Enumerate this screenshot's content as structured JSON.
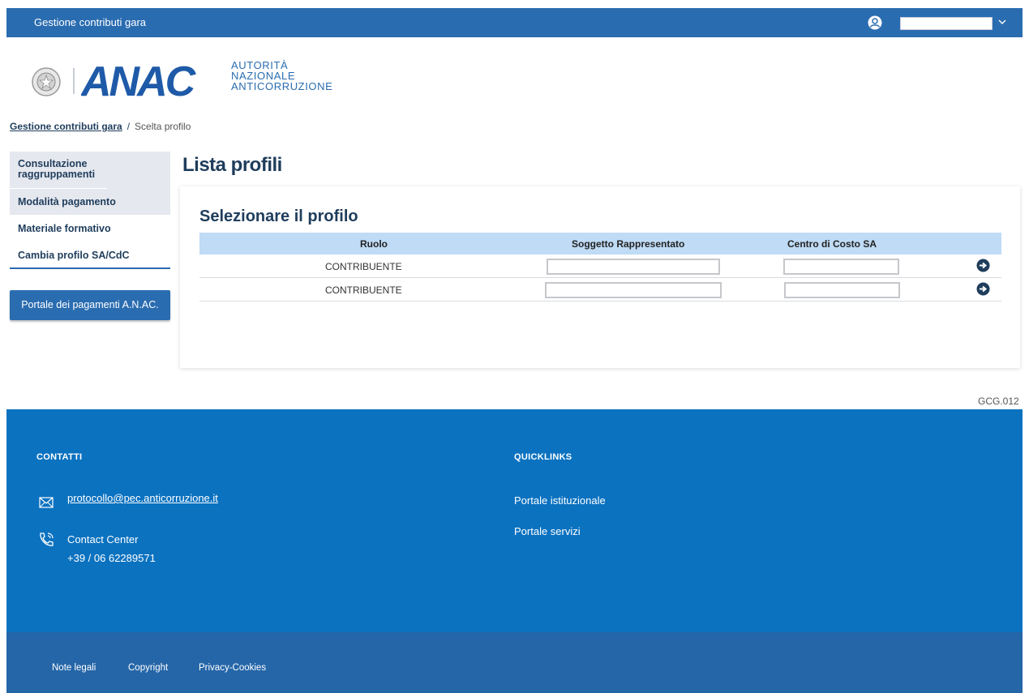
{
  "header": {
    "app_title": "Gestione contributi gara",
    "user_name": ""
  },
  "logo": {
    "line1": "AUTORITÀ",
    "line2": "NAZIONALE",
    "line3": "ANTICORRUZIONE",
    "mark": "ANAC",
    "emblem": "repubblica-emblem-icon"
  },
  "breadcrumb": {
    "root": "Gestione contributi gara",
    "separator": "/",
    "current": "Scelta profilo"
  },
  "sidebar": {
    "items": [
      {
        "label": "Consultazione raggruppamenti"
      },
      {
        "label": "Modalità pagamento"
      },
      {
        "label": "Materiale formativo"
      },
      {
        "label": "Cambia profilo SA/CdC"
      }
    ],
    "portal_button": "Portale dei pagamenti A.N.AC."
  },
  "main": {
    "page_title": "Lista profili",
    "card_title": "Selezionare il profilo",
    "columns": [
      "Ruolo",
      "Soggetto Rappresentato",
      "Centro di Costo SA"
    ],
    "rows": [
      {
        "role": "CONTRIBUENTE",
        "soggetto": "",
        "centro": ""
      },
      {
        "role": "CONTRIBUENTE",
        "soggetto": "",
        "centro": ""
      }
    ]
  },
  "page_code": "GCG.012",
  "footer": {
    "contacts_title": "CONTATTI",
    "email": "protocollo@pec.anticorruzione.it",
    "contact_center": "Contact Center",
    "phone": "+39 / 06 62289571",
    "quicklinks_title": "QUICKLINKS",
    "quicklinks": [
      "Portale istituzionale",
      "Portale servizi"
    ],
    "bottom_links": [
      "Note legali",
      "Copyright",
      "Privacy-Cookies"
    ]
  },
  "colors": {
    "primary": "#2a6cb0",
    "footer": "#0b72c0",
    "footer_bottom": "#2566a8",
    "title": "#1f3d5c",
    "table_header": "#bfdbf5"
  }
}
